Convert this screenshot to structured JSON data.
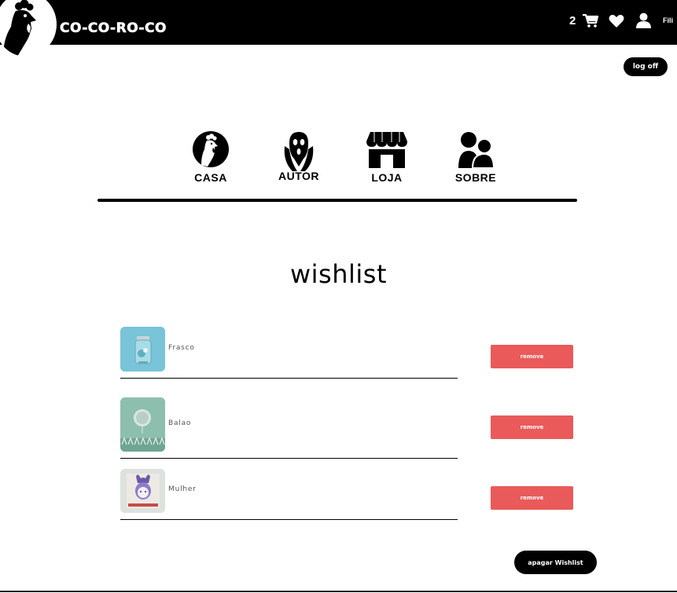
{
  "header": {
    "brand": "CO-CO-RO-CO",
    "cart_count": "2",
    "user_name": "Fili",
    "icons": [
      "rooster-logo-icon",
      "cart-icon",
      "heart-icon",
      "user-icon"
    ]
  },
  "logoff_label": "log off",
  "nav": {
    "items": [
      {
        "label": "CASA",
        "icon": "rooster-circle-icon"
      },
      {
        "label": "AUTOR",
        "icon": "scream-face-icon"
      },
      {
        "label": "LOJA",
        "icon": "store-icon"
      },
      {
        "label": "SOBRE",
        "icon": "people-icon"
      }
    ]
  },
  "page_title": "wishlist",
  "wishlist": {
    "items": [
      {
        "name": "Frasco",
        "remove_label": "remove"
      },
      {
        "name": "Balao",
        "remove_label": "remove"
      },
      {
        "name": "Mulher",
        "remove_label": "remove"
      }
    ],
    "clear_label": "apagar Wishlist"
  },
  "colors": {
    "header_bg": "#000000",
    "remove_button": "#ea5a5a",
    "page_bg": "#ffffff"
  }
}
